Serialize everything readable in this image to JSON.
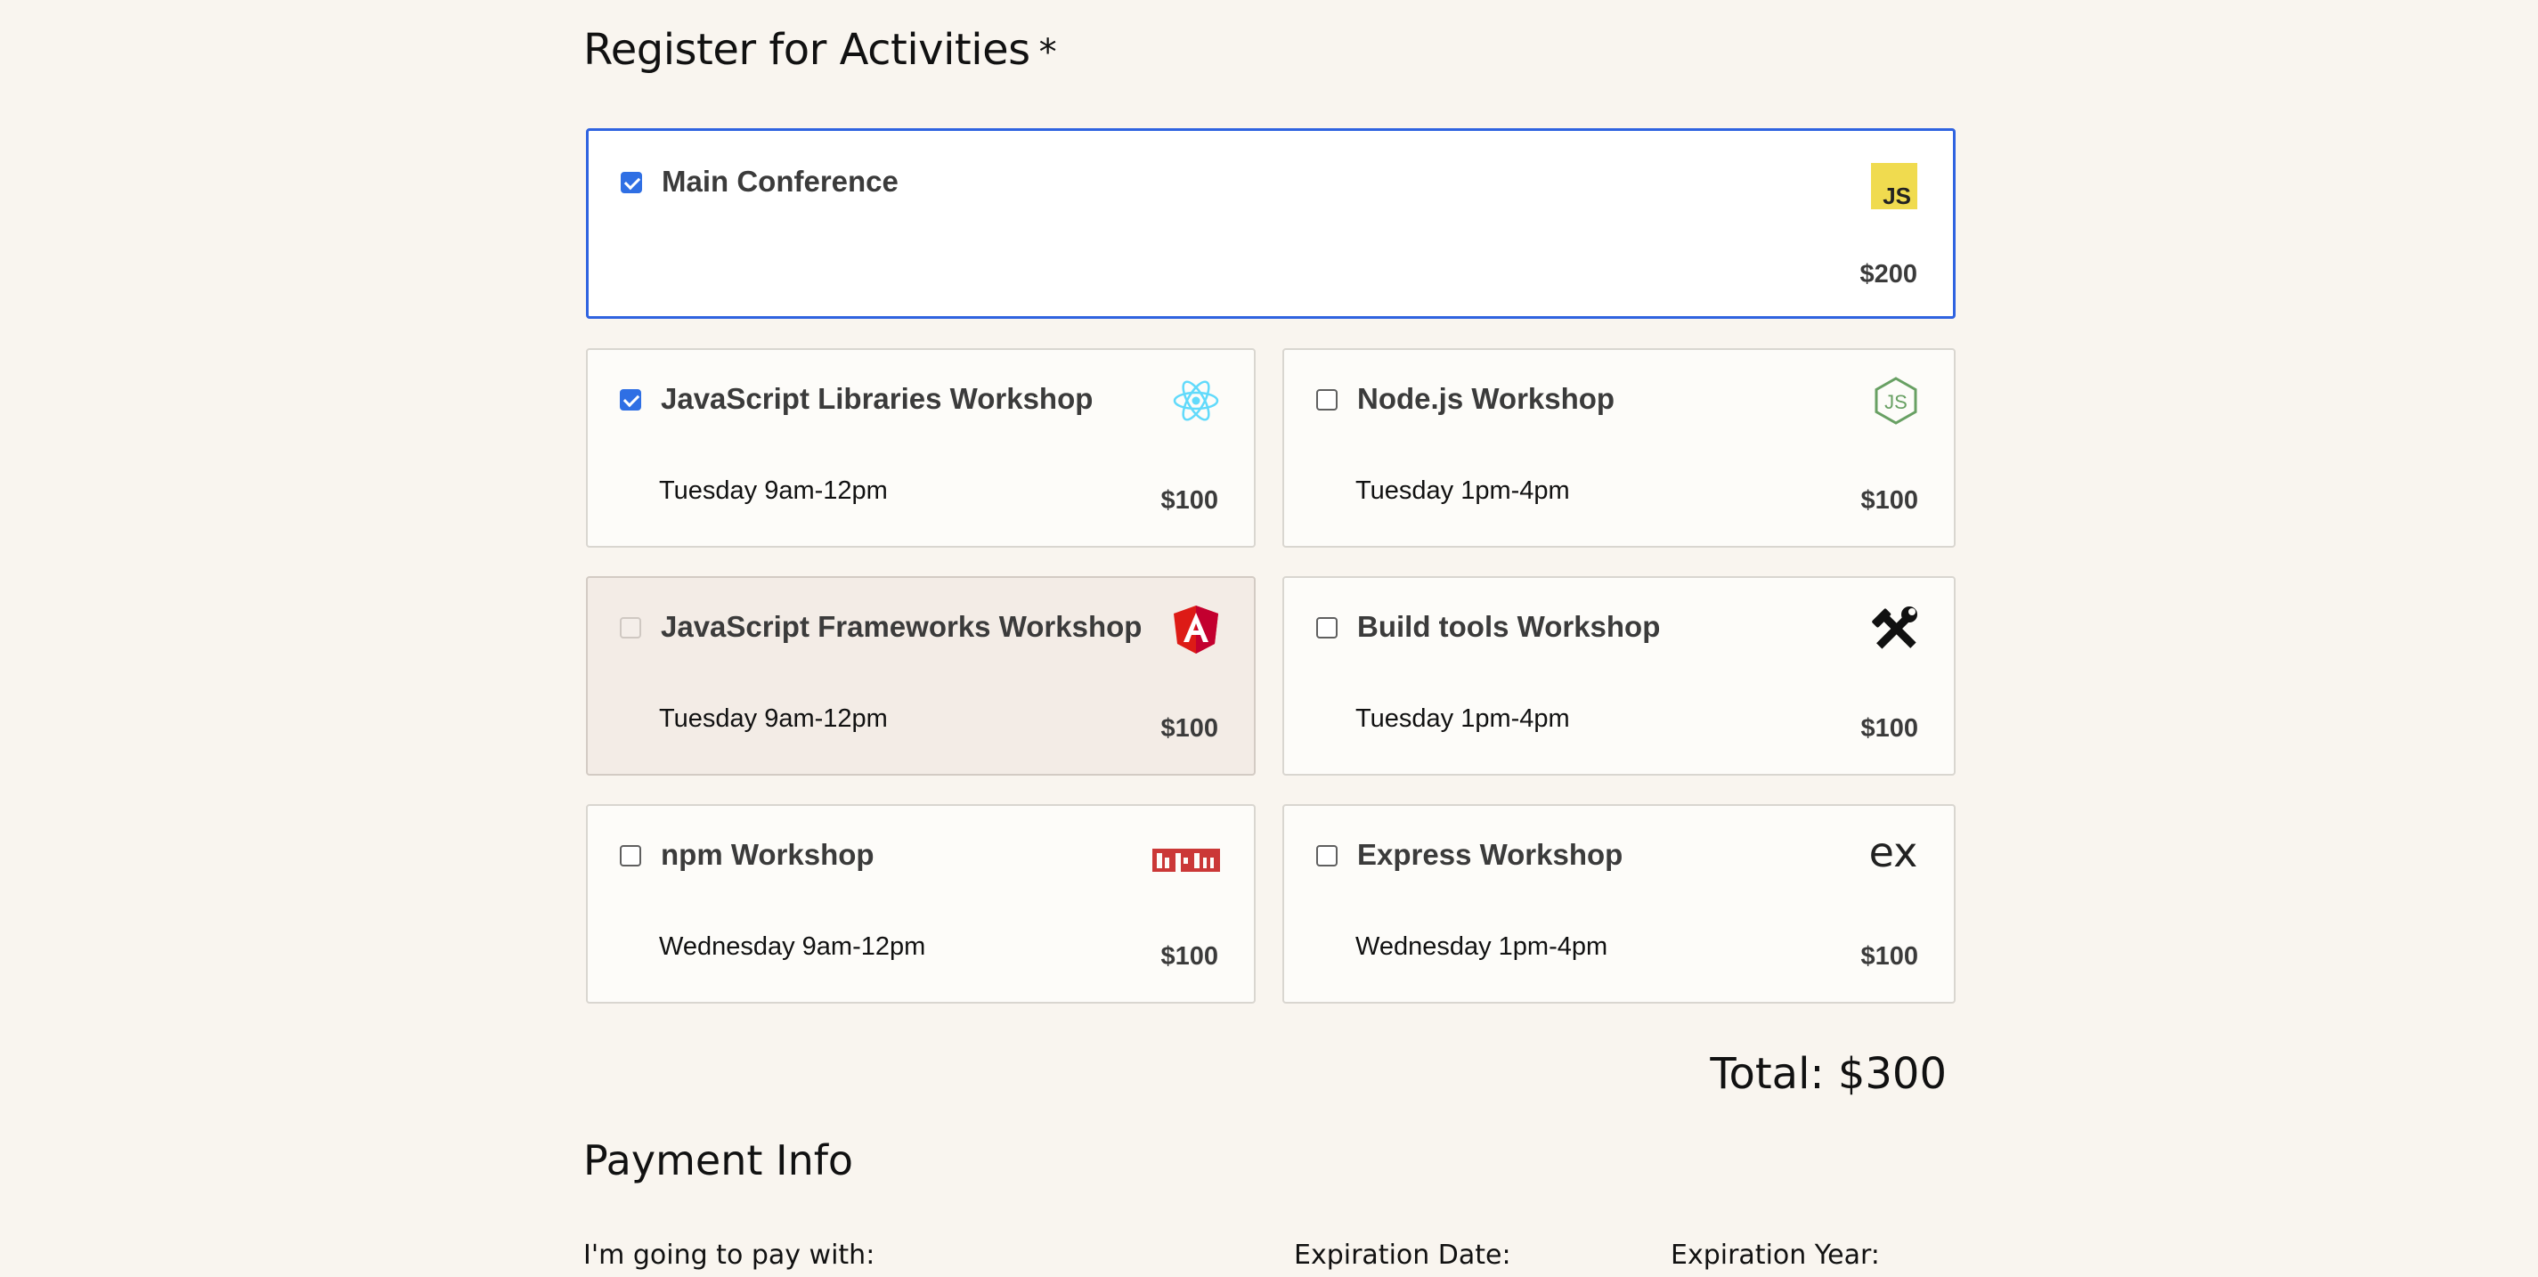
{
  "activities": {
    "heading": "Register for Activities",
    "required_marker": "*",
    "items": [
      {
        "name": "Main Conference",
        "time": "",
        "price": "$200",
        "checked": true,
        "disabled": false,
        "icon": "javascript-logo-icon"
      },
      {
        "name": "JavaScript Libraries Workshop",
        "time": "Tuesday 9am-12pm",
        "price": "$100",
        "checked": true,
        "disabled": false,
        "icon": "react-logo-icon"
      },
      {
        "name": "Node.js Workshop",
        "time": "Tuesday 1pm-4pm",
        "price": "$100",
        "checked": false,
        "disabled": false,
        "icon": "nodejs-logo-icon"
      },
      {
        "name": "JavaScript Frameworks Workshop",
        "time": "Tuesday 9am-12pm",
        "price": "$100",
        "checked": false,
        "disabled": true,
        "icon": "angular-logo-icon"
      },
      {
        "name": "Build tools Workshop",
        "time": "Tuesday 1pm-4pm",
        "price": "$100",
        "checked": false,
        "disabled": false,
        "icon": "tools-icon"
      },
      {
        "name": "npm Workshop",
        "time": "Wednesday 9am-12pm",
        "price": "$100",
        "checked": false,
        "disabled": false,
        "icon": "npm-logo-icon"
      },
      {
        "name": "Express Workshop",
        "time": "Wednesday 1pm-4pm",
        "price": "$100",
        "checked": false,
        "disabled": false,
        "icon": "express-logo-icon"
      }
    ],
    "total": "Total: $300"
  },
  "payment": {
    "heading": "Payment Info",
    "pay_with_label": "I'm going to pay with:",
    "exp_date_label": "Expiration Date:",
    "exp_year_label": "Expiration Year:"
  },
  "colors": {
    "background": "#f9f5ef",
    "accent": "#2f63e0",
    "disabled_card": "#f3ece6",
    "js_yellow": "#f0db4f",
    "react_cyan": "#61dafb",
    "node_green": "#68a063",
    "angular_red": "#dd1b16",
    "npm_red": "#cb3837"
  },
  "icon_glyphs": {
    "js": "JS",
    "express": "ex"
  }
}
